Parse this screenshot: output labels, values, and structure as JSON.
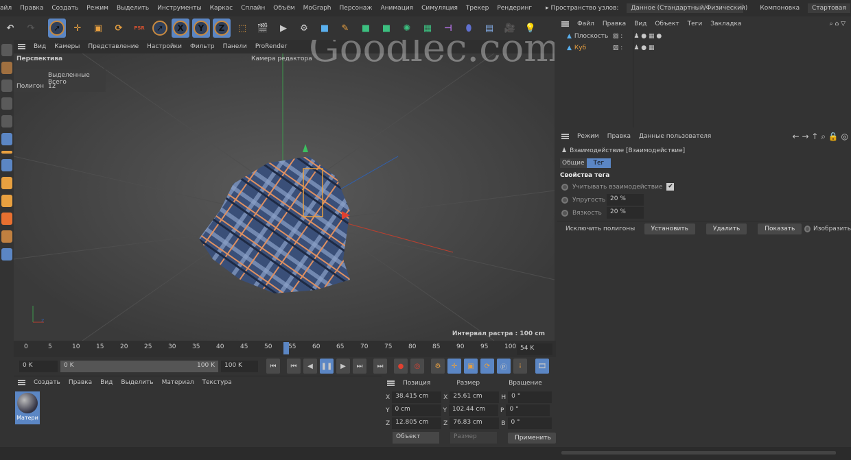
{
  "menu": [
    "айл",
    "Правка",
    "Создать",
    "Режим",
    "Выделить",
    "Инструменты",
    "Каркас",
    "Сплайн",
    "Объём",
    "MoGraph",
    "Персонаж",
    "Анимация",
    "Симуляция",
    "Трекер",
    "Рендеринг"
  ],
  "node_space": {
    "label": "▸ Пространство узлов:",
    "value": "Данное (Стандартный/Физический)"
  },
  "layout": {
    "label": "Компоновка",
    "value": "Стартовая"
  },
  "toolbar": {
    "x": "X",
    "y": "Y",
    "z": "Z",
    "psr": "PSR"
  },
  "viewport": {
    "menu": [
      "Вид",
      "Камеры",
      "Представление",
      "Настройки",
      "Фильтр",
      "Панели",
      "ProRender"
    ],
    "view_name": "Перспектива",
    "camera": "Камера редактора",
    "stats_header": "Выделенные Всего",
    "stats_label": "Полигон",
    "stats_value": "12",
    "grid": "Интервал растра : 100 cm"
  },
  "watermark": "Goodlec.com",
  "timeline": {
    "ticks": [
      "0",
      "5",
      "10",
      "15",
      "20",
      "25",
      "30",
      "35",
      "40",
      "45",
      "50",
      "55",
      "60",
      "65",
      "70",
      "75",
      "80",
      "85",
      "90",
      "95",
      "100"
    ],
    "current_frame_fraction": 0.54,
    "end_field": "54 K"
  },
  "controls": {
    "start": "0 K",
    "range_start": "0 K",
    "range_end": "100 K",
    "end": "100 K"
  },
  "material_manager": {
    "menu": [
      "Создать",
      "Правка",
      "Вид",
      "Выделить",
      "Материал",
      "Текстура"
    ],
    "material": "Матери"
  },
  "coords": {
    "headers": [
      "Позиция",
      "Размер",
      "Вращение"
    ],
    "rows": [
      {
        "a": "X",
        "pos": "38.415 cm",
        "b": "X",
        "size": "25.61 cm",
        "c": "H",
        "rot": "0 °"
      },
      {
        "a": "Y",
        "pos": "0 cm",
        "b": "Y",
        "size": "102.44 cm",
        "c": "P",
        "rot": "0 °"
      },
      {
        "a": "Z",
        "pos": "12.805 cm",
        "b": "Z",
        "size": "76.83 cm",
        "c": "B",
        "rot": "0 °"
      }
    ],
    "mode": "Объект",
    "size_mode": "Размер",
    "apply": "Применить"
  },
  "object_manager": {
    "menu": [
      "Файл",
      "Правка",
      "Вид",
      "Объект",
      "Теги",
      "Закладка"
    ],
    "objects": [
      "Плоскость",
      "Куб"
    ]
  },
  "attributes": {
    "menu": [
      "Режим",
      "Правка",
      "Данные пользователя"
    ],
    "title": "Взаимодействие [Взаимодействие]",
    "tabs": [
      "Общие",
      "Тег"
    ],
    "section": "Свойства тега",
    "collide_label": "Учитывать взаимодействие",
    "elasticity_label": "Упругость",
    "elasticity": "20 %",
    "friction_label": "Вязкость",
    "friction": "20 %",
    "exclude_label": "Исключить полигоны",
    "set": "Установить",
    "remove": "Удалить",
    "show": "Показать",
    "display": "Изобразить"
  }
}
